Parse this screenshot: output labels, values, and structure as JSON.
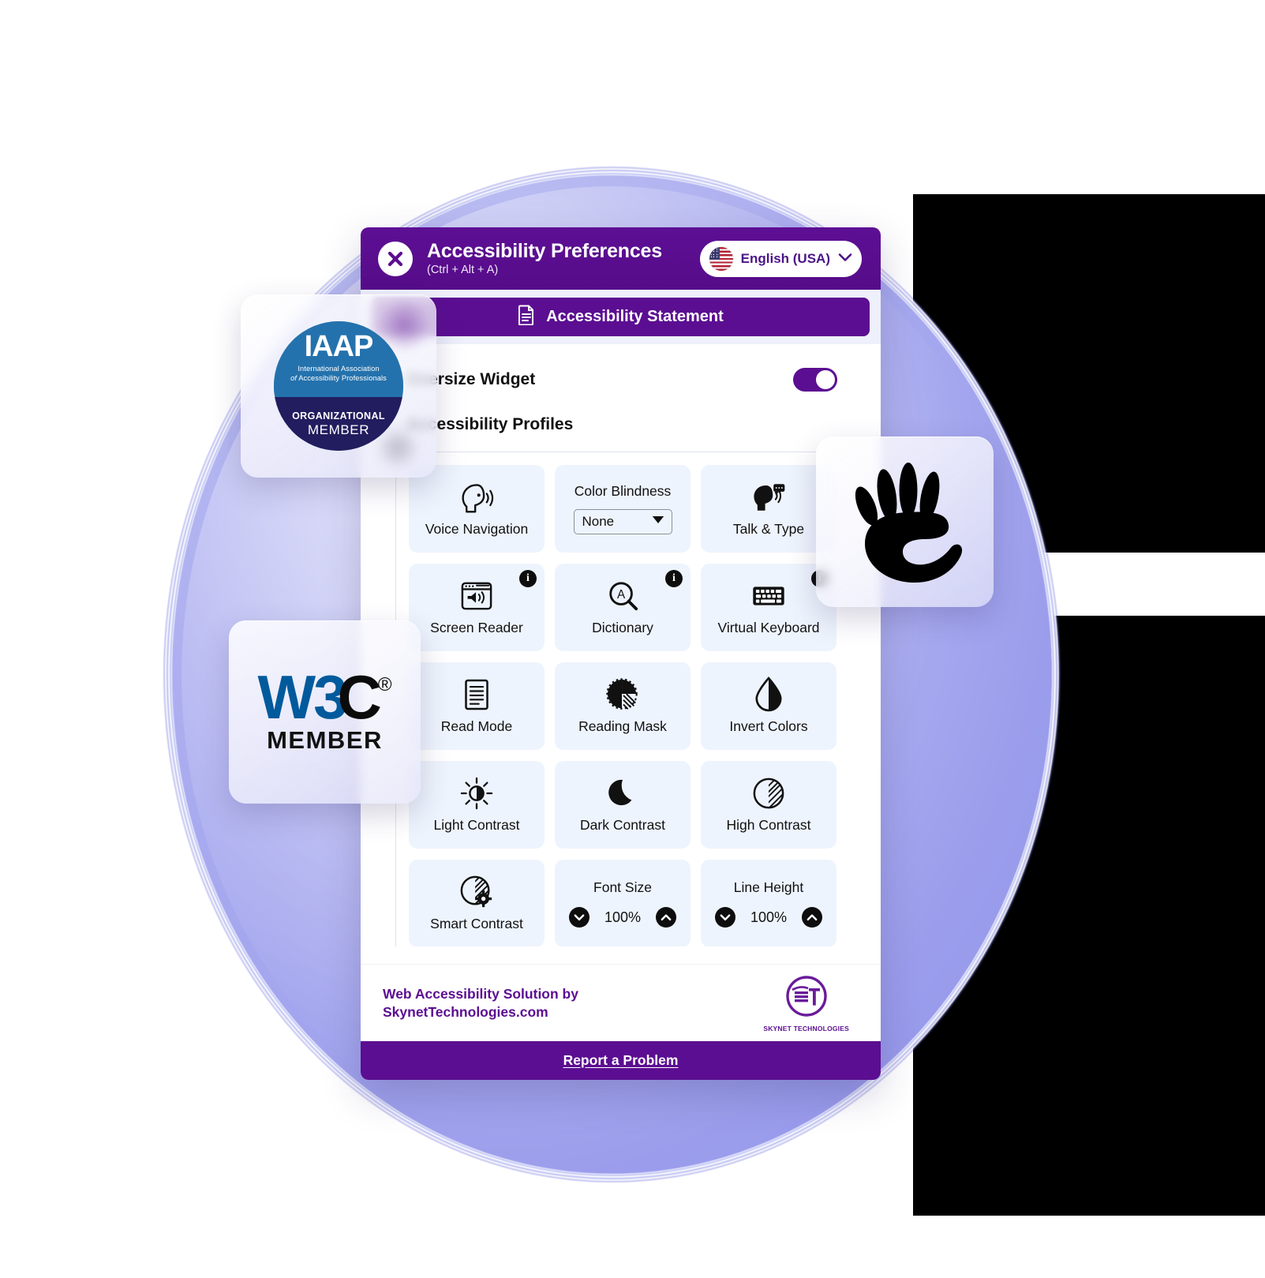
{
  "header": {
    "close_icon": "close-x-icon",
    "title": "Accessibility Preferences",
    "shortcut": "(Ctrl + Alt + A)",
    "language": {
      "flag_icon": "us-flag-icon",
      "label": "English (USA)",
      "chevron_icon": "chevron-down-icon"
    },
    "brand_purple": "#5b0e91"
  },
  "statement": {
    "icon": "document-icon",
    "label": "Accessibility Statement"
  },
  "controls": {
    "oversize_widget_label": "Oversize Widget",
    "oversize_widget_on": true,
    "profiles_label": "Accessibility Profiles"
  },
  "tiles": [
    {
      "id": "voice-navigation",
      "label": "Voice Navigation",
      "icon": "head-speaking-icon",
      "type": "toggle",
      "info": false
    },
    {
      "id": "color-blindness",
      "label": "Color Blindness",
      "icon": "none",
      "type": "select",
      "value": "None",
      "info": false
    },
    {
      "id": "talk-and-type",
      "label": "Talk & Type",
      "icon": "head-talk-type-icon",
      "type": "toggle",
      "info": false
    },
    {
      "id": "screen-reader",
      "label": "Screen Reader",
      "icon": "screen-reader-icon",
      "type": "toggle",
      "info": true
    },
    {
      "id": "dictionary",
      "label": "Dictionary",
      "icon": "dictionary-magnifier-icon",
      "type": "toggle",
      "info": true
    },
    {
      "id": "virtual-keyboard",
      "label": "Virtual Keyboard",
      "icon": "keyboard-icon",
      "type": "toggle",
      "info": true
    },
    {
      "id": "read-mode",
      "label": "Read Mode",
      "icon": "document-lines-icon",
      "type": "toggle",
      "info": false
    },
    {
      "id": "reading-mask",
      "label": "Reading Mask",
      "icon": "reading-mask-icon",
      "type": "toggle",
      "info": false
    },
    {
      "id": "invert-colors",
      "label": "Invert Colors",
      "icon": "droplet-half-icon",
      "type": "toggle",
      "info": false
    },
    {
      "id": "light-contrast",
      "label": "Light Contrast",
      "icon": "sun-half-icon",
      "type": "toggle",
      "info": false
    },
    {
      "id": "dark-contrast",
      "label": "Dark Contrast",
      "icon": "moon-icon",
      "type": "toggle",
      "info": false
    },
    {
      "id": "high-contrast",
      "label": "High Contrast",
      "icon": "circle-half-hatched-icon",
      "type": "toggle",
      "info": false
    },
    {
      "id": "smart-contrast",
      "label": "Smart Contrast",
      "icon": "circle-hatched-gear-icon",
      "type": "toggle",
      "info": false
    },
    {
      "id": "font-size",
      "label": "Font Size",
      "icon": "none",
      "type": "stepper",
      "value": "100%",
      "info": false
    },
    {
      "id": "line-height",
      "label": "Line Height",
      "icon": "none",
      "type": "stepper",
      "value": "100%",
      "info": false
    }
  ],
  "stepper_icons": {
    "decrease": "chevron-down-icon",
    "increase": "chevron-up-icon"
  },
  "select_icon": "caret-down-icon",
  "footer": {
    "credit_line1": "Web Accessibility Solution by",
    "credit_line2": "SkynetTechnologies.com",
    "logo_mark": "st-monogram-icon",
    "logo_name": "SKYNET TECHNOLOGIES",
    "report_label": "Report a Problem"
  },
  "badges": {
    "iaap": {
      "acronym": "IAAP",
      "line1": "International Association",
      "line2_italic": "of",
      "line2": "Accessibility Professionals",
      "tier": "ORGANIZATIONAL",
      "member": "MEMBER",
      "blue": "#2472ad",
      "navy": "#221d5e"
    },
    "w3c": {
      "w3": "W3",
      "c": "C",
      "registered": "®",
      "member": "MEMBER",
      "blue": "#005a9c"
    },
    "hand": {
      "icon": "accessibility-hand-icon",
      "label": "accessibility-hand"
    }
  }
}
